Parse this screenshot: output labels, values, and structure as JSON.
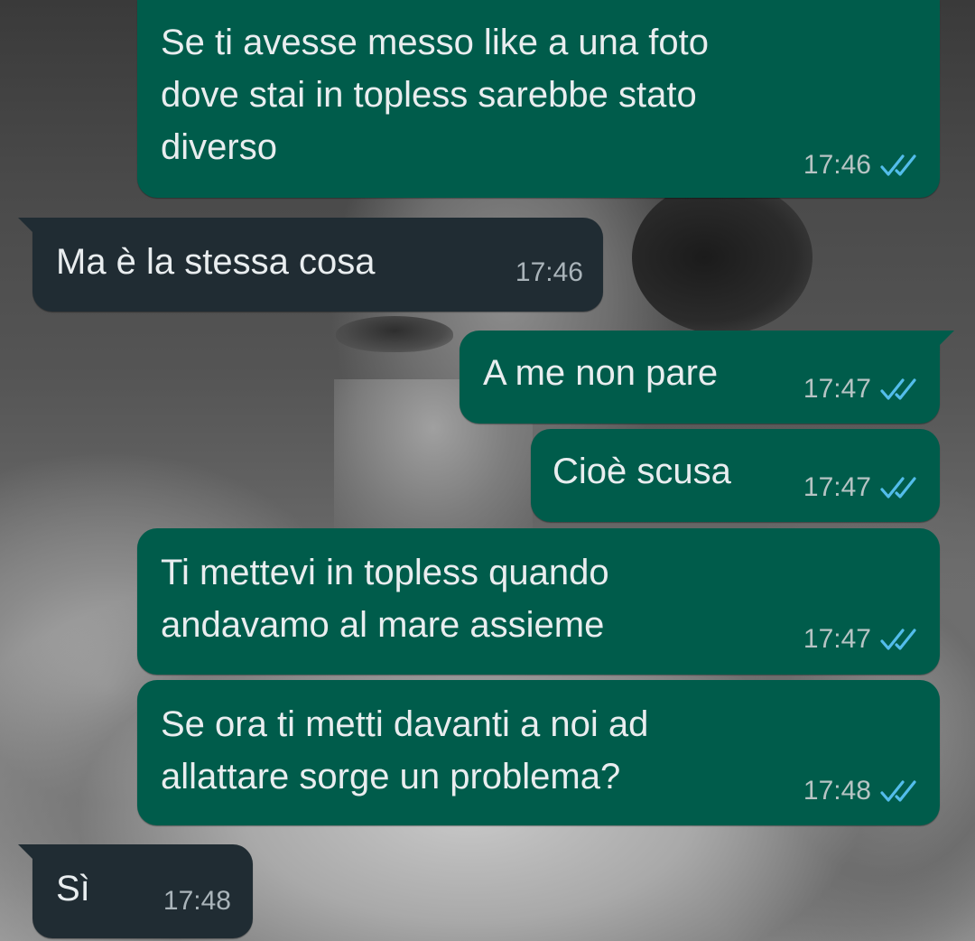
{
  "messages": [
    {
      "direction": "outgoing",
      "lines": [
        "Se ti avesse messo like a una foto",
        "dove stai in topless sarebbe stato",
        "diverso"
      ],
      "time": "17:46",
      "status_icon": "double-check-icon"
    },
    {
      "direction": "incoming",
      "lines": [
        "Ma è la stessa cosa"
      ],
      "time": "17:46"
    },
    {
      "direction": "outgoing",
      "lines": [
        "A me non pare"
      ],
      "time": "17:47",
      "status_icon": "double-check-icon"
    },
    {
      "direction": "outgoing",
      "lines": [
        "Cioè scusa"
      ],
      "time": "17:47",
      "status_icon": "double-check-icon"
    },
    {
      "direction": "outgoing",
      "lines": [
        "Ti mettevi in topless quando",
        "andavamo al mare assieme"
      ],
      "time": "17:47",
      "status_icon": "double-check-icon"
    },
    {
      "direction": "outgoing",
      "lines": [
        "Se ora ti metti davanti a noi ad",
        "allattare sorge un problema?"
      ],
      "time": "17:48",
      "status_icon": "double-check-icon"
    },
    {
      "direction": "incoming",
      "lines": [
        "Sì"
      ],
      "time": "17:48"
    }
  ],
  "colors": {
    "outgoing_bubble": "#005c4b",
    "incoming_bubble": "#202c33",
    "read_ticks": "#53bdeb",
    "text": "#e9edef"
  }
}
